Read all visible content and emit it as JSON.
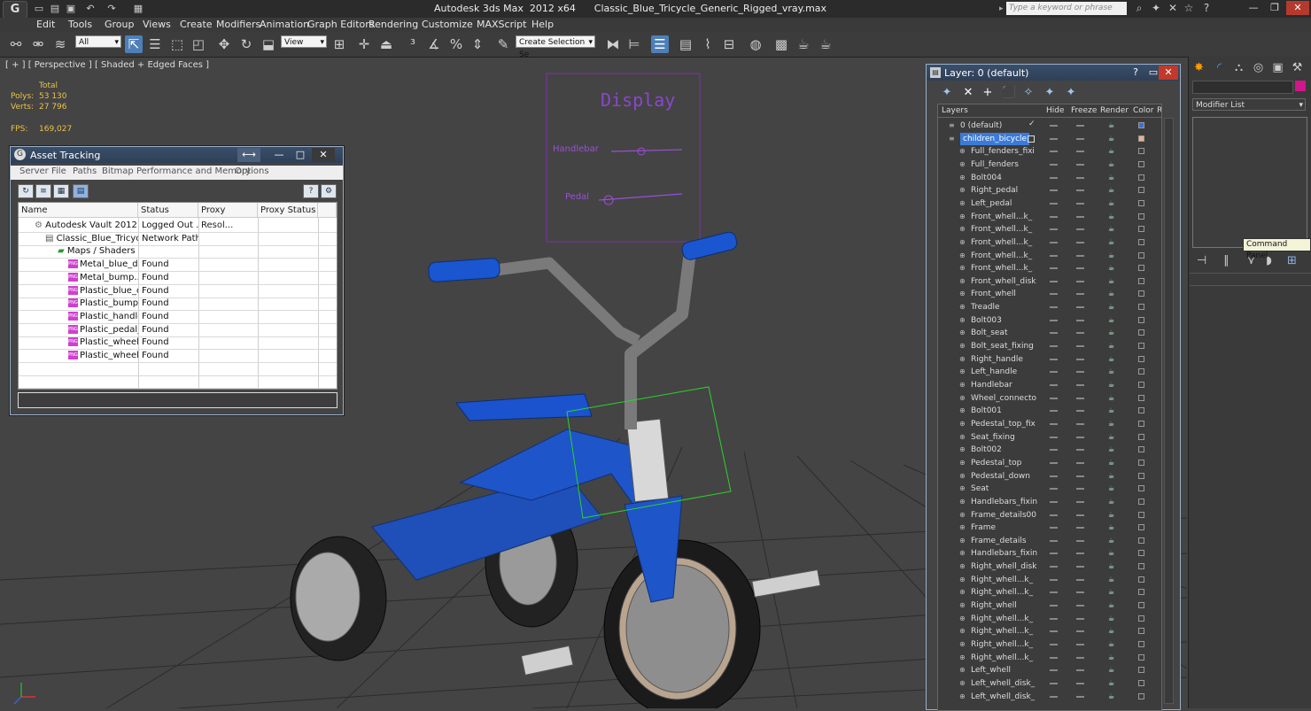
{
  "app": {
    "logo": "G",
    "title": "Autodesk 3ds Max  2012 x64      Classic_Blue_Tricycle_Generic_Rigged_vray.max",
    "search_placeholder": "Type a keyword or phrase",
    "title_icons": [
      "binoculars-icon",
      "subscription-icon",
      "communication-icon",
      "favorites-icon",
      "help-icon"
    ],
    "window_controls": [
      "minimize",
      "maximize",
      "close"
    ]
  },
  "menu": [
    "Edit",
    "Tools",
    "Group",
    "Views",
    "Create",
    "Modifiers",
    "Animation",
    "Graph Editors",
    "Rendering",
    "Customize",
    "MAXScript",
    "Help"
  ],
  "toolbar": {
    "selection_filter": "All",
    "reference_coord": "View",
    "named_selection_placeholder": "Create Selection Se"
  },
  "viewport": {
    "label": "[ + ] [ Perspective ] [ Shaded + Edged Faces ]",
    "stats": {
      "header": "Total",
      "polys_label": "Polys:",
      "polys_value": "53 130",
      "verts_label": "Verts:",
      "verts_value": "27 796",
      "fps_label": "FPS:",
      "fps_value": "169,027"
    },
    "rig": {
      "title": "Display",
      "slider1_label": "Handlebar",
      "slider2_label": "Pedal"
    }
  },
  "asset_tracking": {
    "title": "Asset Tracking",
    "menu": [
      "Server",
      "File",
      "Paths",
      "Bitmap Performance and Memory",
      "Options"
    ],
    "columns": [
      "Name",
      "Status",
      "Proxy Resol...",
      "Proxy Status"
    ],
    "rows": [
      {
        "name": "Autodesk Vault 2012",
        "status": "Logged Out ...",
        "level": 0
      },
      {
        "name": "Classic_Blue_Tricycl...",
        "status": "Network Path",
        "level": 1
      },
      {
        "name": "Maps / Shaders",
        "status": "",
        "level": 2
      },
      {
        "name": "Metal_blue_di...",
        "status": "Found",
        "level": 3
      },
      {
        "name": "Metal_bump....",
        "status": "Found",
        "level": 3
      },
      {
        "name": "Plastic_blue_d...",
        "status": "Found",
        "level": 3
      },
      {
        "name": "Plastic_bump....",
        "status": "Found",
        "level": 3
      },
      {
        "name": "Plastic_handle...",
        "status": "Found",
        "level": 3
      },
      {
        "name": "Plastic_pedal_...",
        "status": "Found",
        "level": 3
      },
      {
        "name": "Plastic_wheel_...",
        "status": "Found",
        "level": 3
      },
      {
        "name": "Plastic_wheel_...",
        "status": "Found",
        "level": 3
      }
    ]
  },
  "layers": {
    "title": "Layer: 0 (default)",
    "columns": [
      "Layers",
      "Hide",
      "Freeze",
      "Render",
      "Color",
      "R"
    ],
    "top": [
      {
        "name": "0 (default)",
        "color": "#3a6fd8"
      },
      {
        "name": "children_bicycle",
        "color": "#e8b090",
        "selected": true
      }
    ],
    "objects": [
      "Full_fenders_fixi",
      "Full_fenders",
      "Bolt004",
      "Right_pedal",
      "Left_pedal",
      "Front_whell...k_",
      "Front_whell...k_",
      "Front_whell...k_",
      "Front_whell...k_",
      "Front_whell...k_",
      "Front_whell_disk",
      "Front_whell",
      "Treadle",
      "Bolt003",
      "Bolt_seat",
      "Bolt_seat_fixing",
      "Right_handle",
      "Left_handle",
      "Handlebar",
      "Wheel_connecto",
      "Bolt001",
      "Pedestal_top_fix",
      "Seat_fixing",
      "Bolt002",
      "Pedestal_top",
      "Pedestal_down",
      "Seat",
      "Handlebars_fixin",
      "Frame_details00",
      "Frame",
      "Frame_details",
      "Handlebars_fixin",
      "Right_whell_disk",
      "Right_whell...k_",
      "Right_whell...k_",
      "Right_whell",
      "Right_whell...k_",
      "Right_whell...k_",
      "Right_whell...k_",
      "Right_whell...k_",
      "Left_whell",
      "Left_whell_disk_",
      "Left_whell_disk_"
    ]
  },
  "command_panel": {
    "modifier_list": "Modifier List",
    "tooltip": "Command Panel",
    "swatch_color": "#d0168a"
  }
}
